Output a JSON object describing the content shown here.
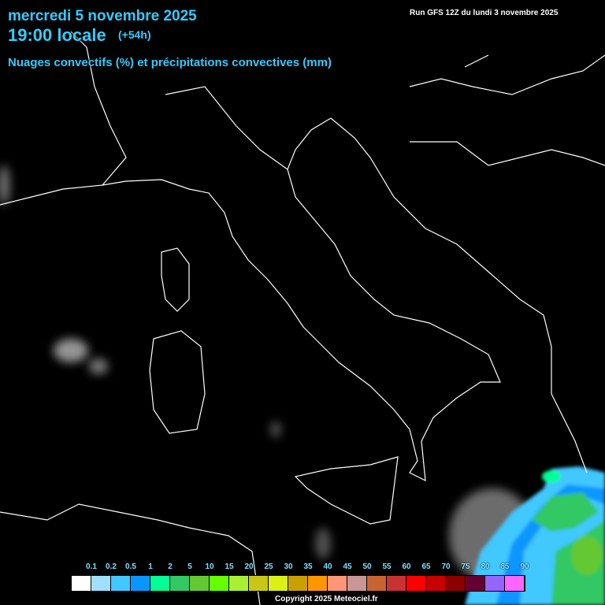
{
  "header": {
    "date": "mercredi 5 novembre 2025",
    "hour": "19:00 locale",
    "step": "(+54h)",
    "parameter": "Nuages convectifs (%) et précipitations convectives (mm)",
    "run": "Run GFS 12Z du lundi 3 novembre 2025"
  },
  "legend": {
    "labels": [
      "0.1",
      "0.2",
      "0.5",
      "1",
      "2",
      "5",
      "10",
      "15",
      "20",
      "25",
      "30",
      "35",
      "40",
      "45",
      "50",
      "55",
      "60",
      "65",
      "70",
      "75",
      "80",
      "85",
      "90"
    ],
    "colors": [
      "#ffffff",
      "#a0e0ff",
      "#40c8ff",
      "#0a96ff",
      "#00ff96",
      "#32c864",
      "#64c832",
      "#64ff00",
      "#aaf032",
      "#c8c814",
      "#dcf014",
      "#c8a000",
      "#ff9600",
      "#ff9678",
      "#c89696",
      "#c86432",
      "#c83232",
      "#ff0000",
      "#c80000",
      "#8c0000",
      "#640032",
      "#9664ff",
      "#ff64ff"
    ]
  },
  "copyright": "Copyright 2025 Meteociel.fr"
}
